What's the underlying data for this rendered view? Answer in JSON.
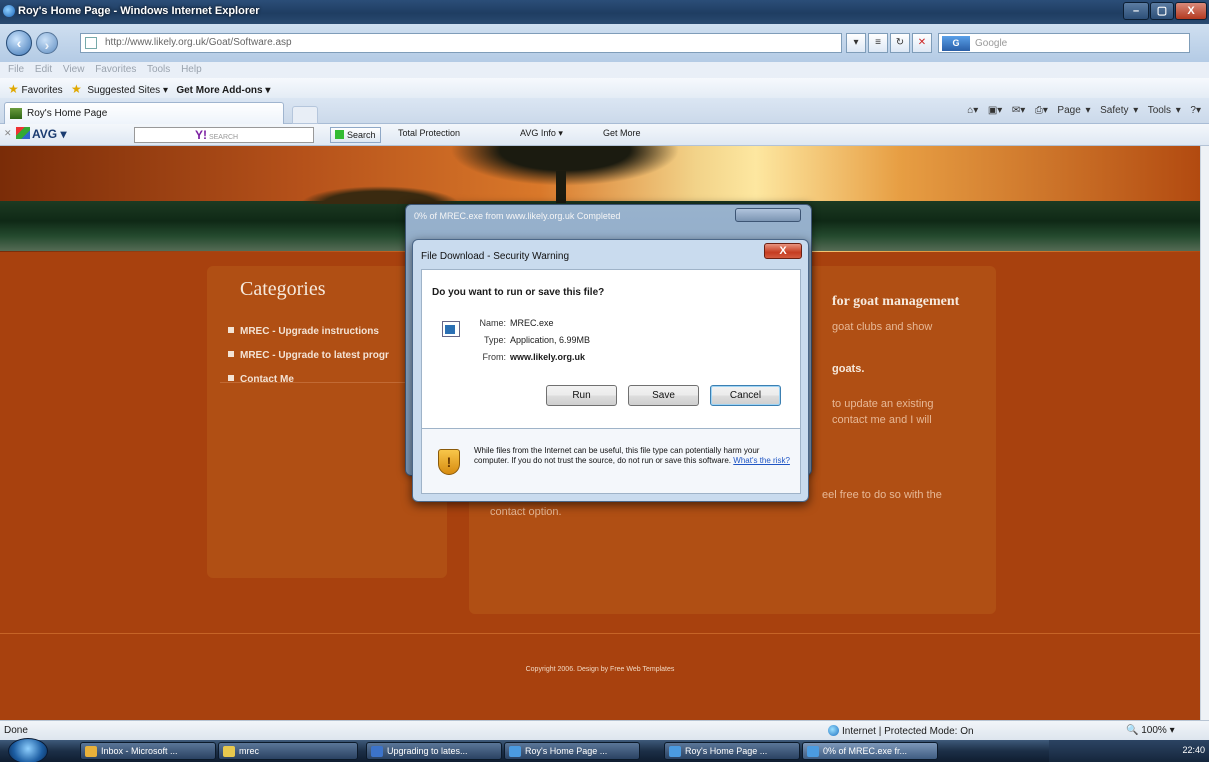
{
  "window": {
    "title": "Roy's Home Page - Windows Internet Explorer",
    "min": "–",
    "max": "▢",
    "close": "X"
  },
  "address": {
    "url": "http://www.likely.org.uk/Goat/Software.asp",
    "search_placeholder": "Google"
  },
  "menu": {
    "items": [
      "File",
      "Edit",
      "View",
      "Favorites",
      "Tools",
      "Help"
    ]
  },
  "favorites": {
    "label": "Favorites",
    "suggested": "Suggested Sites ▾",
    "addons": "Get More Add-ons ▾"
  },
  "tab": {
    "label": "Roy's Home Page"
  },
  "command_bar": {
    "page": "Page ▾",
    "safety": "Safety ▾",
    "tools": "Tools ▾",
    "help": "?▾"
  },
  "avg": {
    "brand": "AVG ▾",
    "search_btn": "Search",
    "total_protection": "Total Protection",
    "avg_info": "AVG Info ▾",
    "get_more": "Get More"
  },
  "page": {
    "categories_title": "Categories",
    "categories": [
      "MREC - Upgrade instructions",
      "MREC - Upgrade to latest progr",
      "Contact Me"
    ],
    "content_title": "for goat management",
    "content_line1": "goat clubs and show",
    "content_bold": "goats.",
    "content_line2": "to update an existing",
    "content_line3": "contact me and I will",
    "content_line4": "eel free to do so with the",
    "content_line5": "contact option.",
    "footer": "Copyright 2006. Design by Free Web Templates"
  },
  "bg_dialog": {
    "title": "0% of MREC.exe from www.likely.org.uk Completed"
  },
  "dialog": {
    "title": "File Download - Security Warning",
    "close": "X",
    "question": "Do you want to run or save this file?",
    "name_label": "Name:",
    "name_value": "MREC.exe",
    "type_label": "Type:",
    "type_value": "Application, 6.99MB",
    "from_label": "From:",
    "from_value": "www.likely.org.uk",
    "run": "Run",
    "save": "Save",
    "cancel": "Cancel",
    "warning": "While files from the Internet can be useful, this file type can potentially harm your computer. If you do not trust the source, do not run or save this software.",
    "risk_link": "What's the risk?"
  },
  "status": {
    "left": "Done",
    "zone": "Internet | Protected Mode: On",
    "zoom": "100%"
  },
  "taskbar": {
    "buttons": [
      "Inbox - Microsoft ...",
      "mrec",
      "Upgrading to lates...",
      "Roy's Home Page ...",
      "Roy's Home Page ...",
      "0% of MREC.exe fr..."
    ],
    "clock": "22:40"
  },
  "colors": {
    "page_bg": "#a8410e",
    "panel": "#b04f14",
    "dialog_frame": "#c9dbee"
  }
}
